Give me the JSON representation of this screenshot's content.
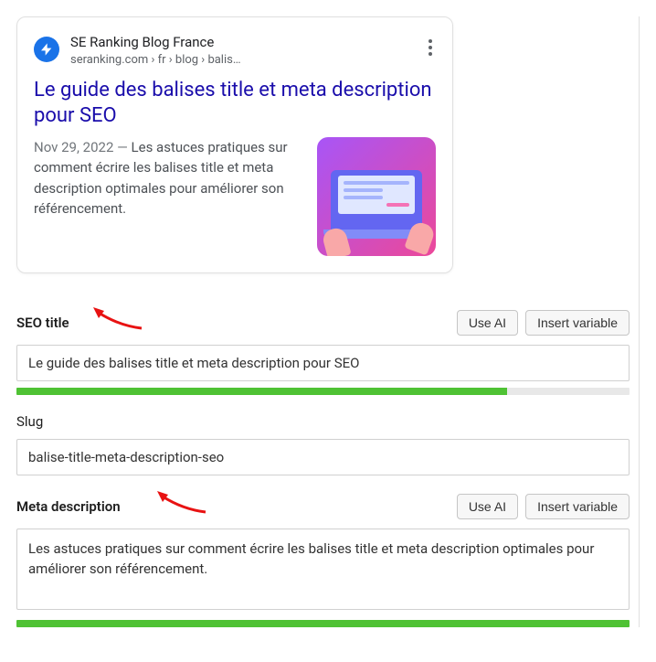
{
  "preview": {
    "site_name": "SE Ranking Blog France",
    "breadcrumb": "seranking.com › fr › blog › balis…",
    "title": "Le guide des balises title et meta description pour SEO",
    "date": "Nov 29, 2022",
    "separator": "  —  ",
    "description": "Les astuces pratiques sur comment écrire les balises title et meta description optimales pour améliorer son référencement."
  },
  "fields": {
    "seo_title": {
      "label": "SEO title",
      "value": "Le guide des balises title et meta description pour SEO",
      "progress": 80
    },
    "slug": {
      "label": "Slug",
      "value": "balise-title-meta-description-seo"
    },
    "meta_description": {
      "label": "Meta description",
      "value": "Les astuces pratiques sur comment écrire les balises title et meta description optimales pour améliorer son référencement.",
      "progress": 100
    }
  },
  "buttons": {
    "use_ai": "Use AI",
    "insert_variable": "Insert variable"
  }
}
